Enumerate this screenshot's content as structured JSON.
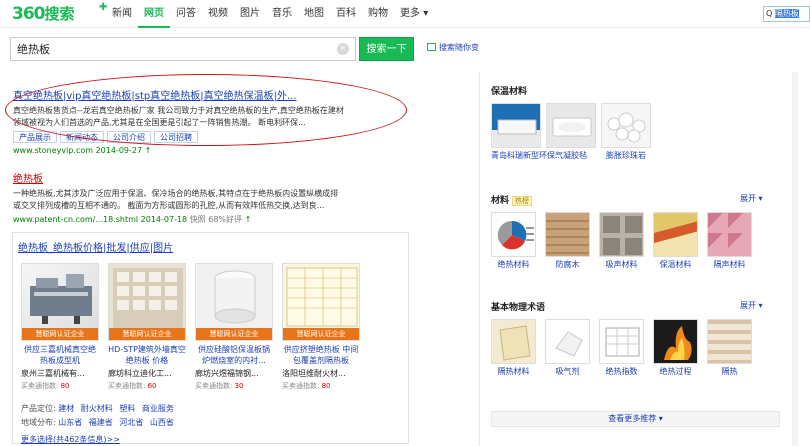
{
  "logo": {
    "number": "360",
    "text": "搜索"
  },
  "nav": [
    "新闻",
    "网页",
    "问答",
    "视频",
    "图片",
    "音乐",
    "地图",
    "百科",
    "购物",
    "更多"
  ],
  "nav_active": "网页",
  "top_right": {
    "prefix": "Q",
    "text": "隔热板"
  },
  "search": {
    "value": "绝热板",
    "button": "搜索一下",
    "follow": "搜索随你变"
  },
  "result1": {
    "title": "真空绝热板|vip真空绝热板|stp真空绝热板|真空绝热保温板|外...",
    "snippet_line1": "真空绝热板售货点--龙岩真空绝热板厂家 我公司致力于对真空绝热板的生产,真空绝热板在建材",
    "snippet_line2": "领域被视为人们首选的产品,尤其是在全国更是引起了一阵销售热潮。 断电利环保...",
    "buttons": [
      "产品展示",
      "新闻动态",
      "公司介绍",
      "公司招聘"
    ],
    "url": "www.stoneyvip.com 2014-09-27"
  },
  "result2": {
    "title": "绝热板",
    "snippet_line1": "一种绝热板,尤其涉及广泛应用于保温、保冷场合的绝热板,其特点在于绝热板内设置纵横成排",
    "snippet_line2": "或交叉排列成槽的互相不通的。 截面为方形或圆形的孔腔,从而有效阵低热交换,达到良...",
    "url": "www.patent-cn.com/...18.shtml 2014-07-18",
    "snapshot": "快照",
    "rating": "68%好评"
  },
  "image_box": {
    "title": "绝热板_绝热板价格|批发|供应|图片",
    "badge": "慧聪网认证企业",
    "cards": [
      {
        "caption": "供应三嘉机械真空绝热板成型机",
        "company": "泉州三嘉机械有...",
        "index_label": "买卖通指数:",
        "index": "80"
      },
      {
        "caption": "HD-STP建筑外墙真空绝热板 价格",
        "company": "廊坊科立迪化工...",
        "index_label": "买卖通指数:",
        "index": "60"
      },
      {
        "caption": "供应硅酸铝保温板锅炉燃烧室的内衬...",
        "company": "廊坊兴煜福锦钢...",
        "index_label": "买卖通指数:",
        "index": "30"
      },
      {
        "caption": "供应挤塑绝热板 中间包覆盖剂隔热板",
        "company": "洛阳坦维耐火材...",
        "index_label": "买卖通指数:",
        "index": "80"
      }
    ],
    "product_label": "产品定位:",
    "product_links": [
      "建材",
      "耐火材料",
      "塑料",
      "商业服务"
    ],
    "region_label": "地域分布:",
    "region_links": [
      "山东省",
      "福建省",
      "河北省",
      "山西省"
    ],
    "more": "更多选择(共462条信息)>>"
  },
  "right": {
    "sec1": {
      "title": "保温材料",
      "items": [
        "青岛科瑞新型环保...",
        "气凝胶毡",
        "膨胀珍珠岩"
      ]
    },
    "sec2": {
      "title": "材料",
      "tag": "热榜",
      "expand": "展开",
      "items": [
        "绝热材料",
        "防腐木",
        "吸声材料",
        "保温材料",
        "隔声材料"
      ]
    },
    "sec3": {
      "title": "基本物理术语",
      "expand": "展开",
      "items": [
        "隔热材料",
        "吸气剂",
        "绝热指数",
        "绝热过程",
        "隔热"
      ]
    },
    "see_more": "查看更多推荐"
  }
}
